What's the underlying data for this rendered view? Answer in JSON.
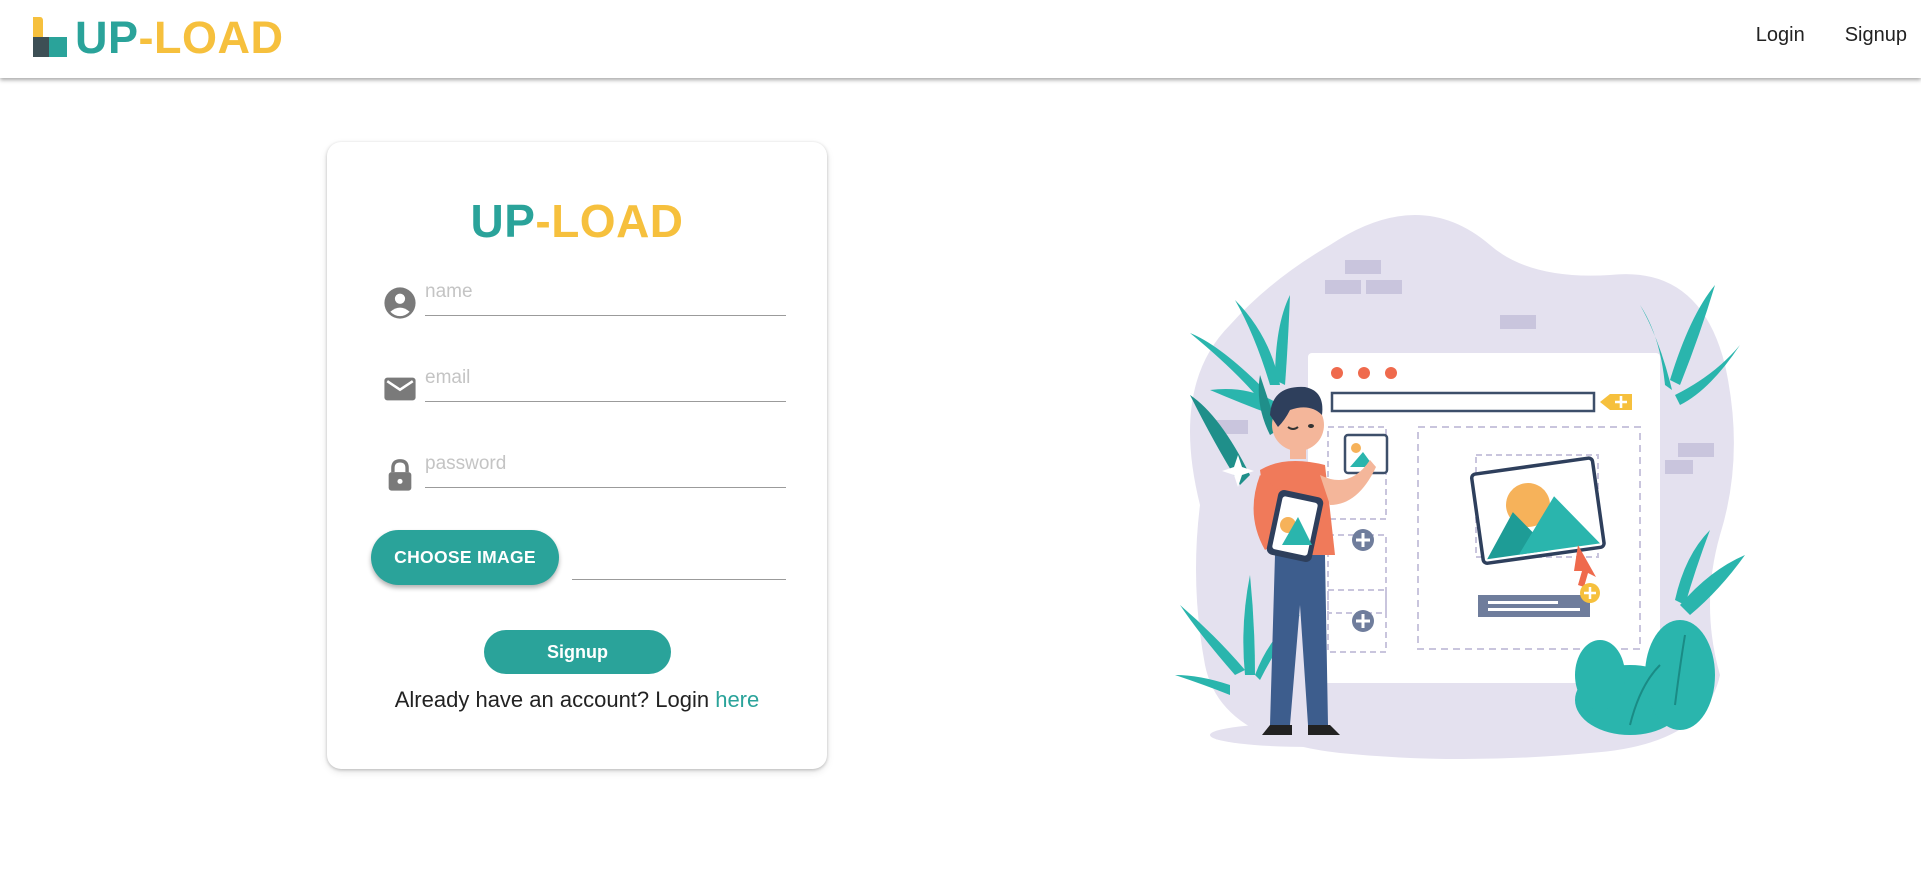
{
  "navbar": {
    "brand_up": "UP",
    "brand_dash": "-",
    "brand_load": "LOAD",
    "links": [
      "Login",
      "Signup"
    ]
  },
  "form": {
    "title_up": "UP",
    "title_dash": "-",
    "title_load": "LOAD",
    "name_placeholder": "name",
    "email_placeholder": "email",
    "password_placeholder": "password",
    "choose_image_label": "CHOOSE IMAGE",
    "signup_label": "Signup",
    "login_prompt": "Already have an account? Login ",
    "login_link": "here"
  },
  "icons": {
    "name": "account-circle-icon",
    "email": "mail-icon",
    "password": "lock-icon"
  },
  "colors": {
    "accent_teal": "#2aa39a",
    "accent_yellow": "#f6c03d",
    "icon_gray": "#7a7a7a"
  }
}
